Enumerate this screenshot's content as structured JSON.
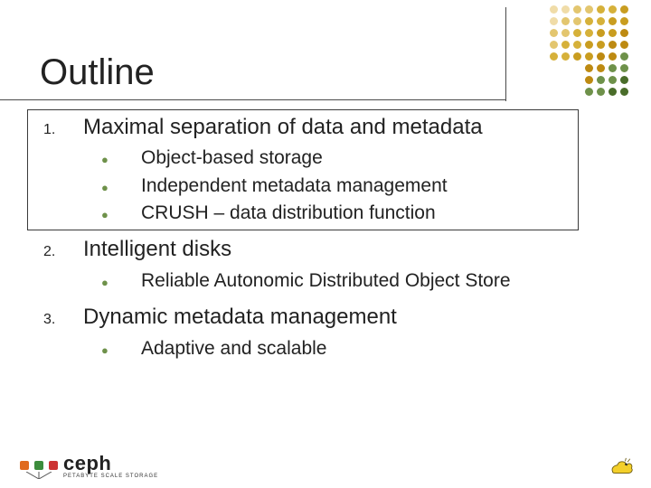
{
  "title": "Outline",
  "colors": {
    "bullet_accent": "#6e914a",
    "dot_colors": [
      "#f0dca8",
      "#e3c66f",
      "#d6b13a",
      "#c99d20",
      "#bd8a12",
      "#6e914a",
      "#4a6d2a"
    ]
  },
  "outline": {
    "items": [
      {
        "num": "1.",
        "label": "Maximal separation of data and metadata",
        "sub": [
          "Object-based storage",
          "Independent metadata management",
          "CRUSH – data distribution function"
        ]
      },
      {
        "num": "2.",
        "label": "Intelligent disks",
        "sub": [
          "Reliable Autonomic Distributed Object Store"
        ]
      },
      {
        "num": "3.",
        "label": "Dynamic metadata management",
        "sub": [
          "Adaptive and scalable"
        ]
      }
    ]
  },
  "footer": {
    "brand_word": "ceph",
    "brand_sub": "PETABYTE SCALE STORAGE"
  }
}
